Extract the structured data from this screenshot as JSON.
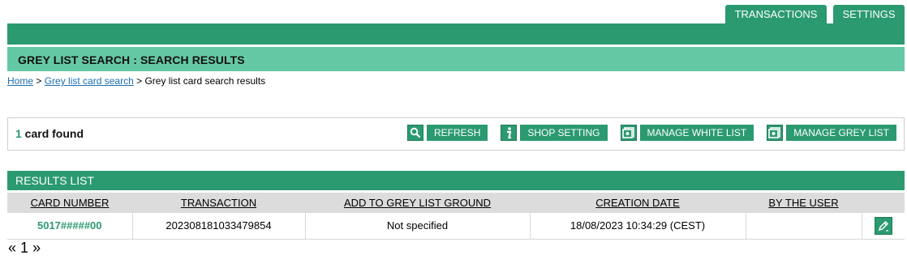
{
  "tabs": [
    {
      "label": "TRANSACTIONS"
    },
    {
      "label": "SETTINGS"
    }
  ],
  "page_title": "GREY LIST SEARCH : SEARCH RESULTS",
  "breadcrumb": {
    "home": "Home",
    "sep1": " > ",
    "search": "Grey list card search",
    "sep2": " > ",
    "current": "Grey list card search results"
  },
  "summary": {
    "count": "1",
    "label": " card found"
  },
  "actions": {
    "refresh": "REFRESH",
    "shop_setting": "SHOP SETTING",
    "manage_white": "MANAGE WHITE LIST",
    "manage_grey": "MANAGE GREY LIST"
  },
  "results": {
    "header": "RESULTS LIST",
    "columns": [
      "CARD NUMBER",
      "TRANSACTION",
      "ADD TO GREY LIST GROUND",
      "CREATION DATE",
      "BY THE USER"
    ],
    "rows": [
      {
        "card": "5017#####00",
        "transaction": "202308181033479854",
        "ground": "Not specified",
        "date": "18/08/2023 10:34:29 (CEST)",
        "user": ""
      }
    ]
  },
  "pager": {
    "prev": "«",
    "page": "1",
    "next": "»"
  },
  "colors": {
    "primary": "#2b9a70",
    "light": "#65c8a4",
    "link": "#1a6fb0"
  }
}
